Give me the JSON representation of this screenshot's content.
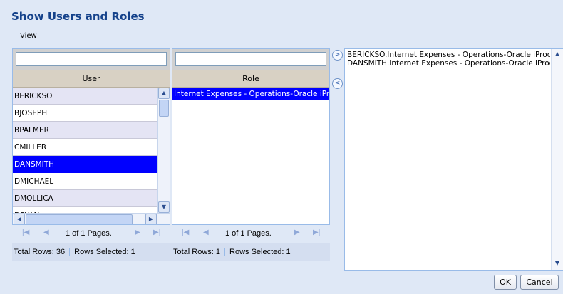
{
  "dialog": {
    "title": "Show Users and Roles",
    "menu_view": "View"
  },
  "users": {
    "filter_value": "",
    "column_header": "User",
    "rows": [
      "BERICKSO",
      "BJOSEPH",
      "BPALMER",
      "CMILLER",
      "DANSMITH",
      "DMICHAEL",
      "DMOLLICA",
      "DRYAN"
    ],
    "selected_row": "DANSMITH",
    "pager_text": "1 of 1 Pages.",
    "total_rows": "Total Rows: 36",
    "rows_selected": "Rows Selected: 1"
  },
  "roles": {
    "filter_value": "",
    "column_header": "Role",
    "rows": [
      "Internet Expenses - Operations-Oracle iProcurement"
    ],
    "selected_row": "Internet Expenses - Operations-Oracle iProcurement",
    "pager_text": "1 of 1 Pages.",
    "total_rows": "Total Rows: 1",
    "rows_selected": "Rows Selected: 1"
  },
  "selected_assignments": [
    "BERICKSO.Internet Expenses - Operations-Oracle iProcurement",
    "DANSMITH.Internet Expenses - Operations-Oracle iProcurement"
  ],
  "buttons": {
    "ok": "OK",
    "cancel": "Cancel"
  },
  "icons": {
    "add": "chevron-right-circle-icon",
    "remove": "chevron-left-circle-icon",
    "first_page": "first-page-icon",
    "prev_page": "previous-page-icon",
    "next_page": "next-page-icon",
    "last_page": "last-page-icon"
  },
  "colors": {
    "background": "#dfe8f6",
    "title": "#15428b",
    "selection": "#0000ff",
    "header": "#d8d1c4"
  }
}
